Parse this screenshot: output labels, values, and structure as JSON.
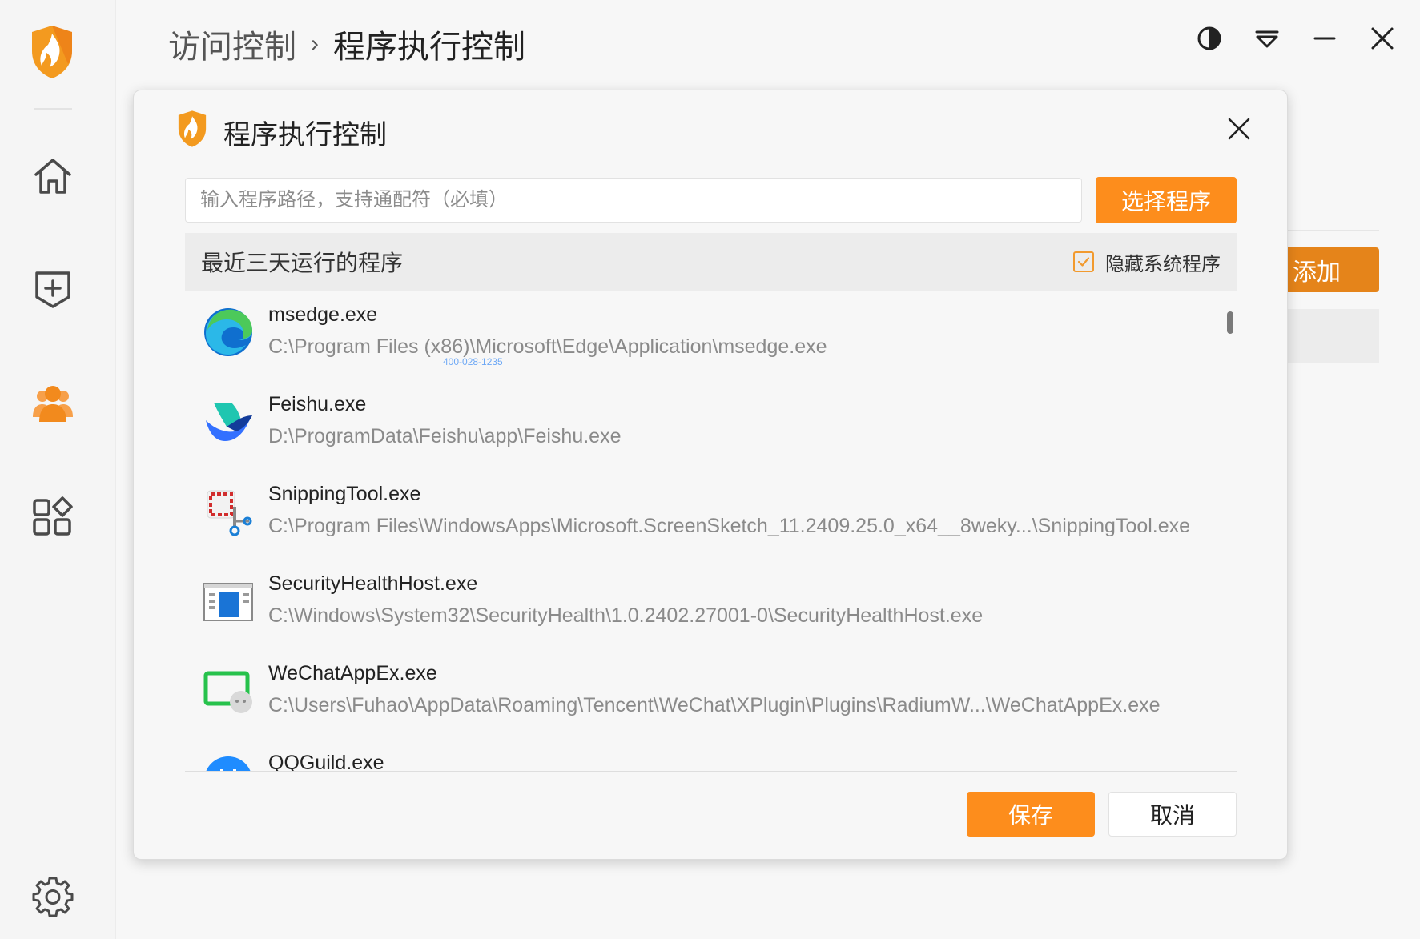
{
  "header": {
    "breadcrumb_parent": "访问控制",
    "breadcrumb_separator": "›",
    "breadcrumb_current": "程序执行控制"
  },
  "background": {
    "add_label": "添加"
  },
  "dialog": {
    "title": "程序执行控制",
    "path_input": {
      "value": "",
      "placeholder": "输入程序路径，支持通配符（必填）"
    },
    "select_button": "选择程序",
    "list_header": "最近三天运行的程序",
    "hide_system": {
      "label": "隐藏系统程序",
      "checked": true
    },
    "programs": [
      {
        "name": "msedge.exe",
        "path": "C:\\Program Files (x86)\\Microsoft\\Edge\\Application\\msedge.exe",
        "icon": "edge-icon"
      },
      {
        "name": "Feishu.exe",
        "path": "D:\\ProgramData\\Feishu\\app\\Feishu.exe",
        "icon": "feishu-icon"
      },
      {
        "name": "SnippingTool.exe",
        "path": "C:\\Program Files\\WindowsApps\\Microsoft.ScreenSketch_11.2409.25.0_x64__8weky...\\SnippingTool.exe",
        "icon": "snipping-tool-icon"
      },
      {
        "name": "SecurityHealthHost.exe",
        "path": "C:\\Windows\\System32\\SecurityHealth\\1.0.2402.27001-0\\SecurityHealthHost.exe",
        "icon": "security-health-icon"
      },
      {
        "name": "WeChatAppEx.exe",
        "path": "C:\\Users\\Fuhao\\AppData\\Roaming\\Tencent\\WeChat\\XPlugin\\Plugins\\RadiumW...\\WeChatAppEx.exe",
        "icon": "wechat-appex-icon"
      },
      {
        "name": "QQGuild.exe",
        "path": "",
        "icon": "qqguild-icon"
      }
    ],
    "watermark_line2": "400-028-1235",
    "save_button": "保存",
    "cancel_button": "取消"
  },
  "colors": {
    "accent": "#fd8d1c",
    "accent_dark": "#e5841a",
    "checkbox": "#f29a2e"
  }
}
